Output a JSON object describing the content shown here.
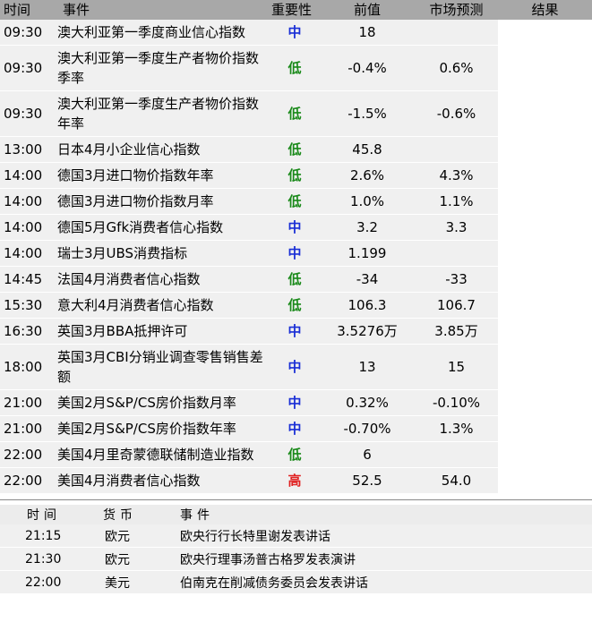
{
  "econ": {
    "headers": [
      "时间",
      "事件",
      "重要性",
      "前值",
      "市场预测",
      "结果"
    ],
    "rows": [
      {
        "time": "09:30",
        "event": "澳大利亚第一季度商业信心指数",
        "imp": "中",
        "lvl": "mid",
        "prev": "18",
        "fcst": ""
      },
      {
        "time": "09:30",
        "event": "澳大利亚第一季度生产者物价指数季率",
        "imp": "低",
        "lvl": "low",
        "prev": "-0.4%",
        "fcst": "0.6%"
      },
      {
        "time": "09:30",
        "event": "澳大利亚第一季度生产者物价指数年率",
        "imp": "低",
        "lvl": "low",
        "prev": "-1.5%",
        "fcst": "-0.6%"
      },
      {
        "time": "13:00",
        "event": "日本4月小企业信心指数",
        "imp": "低",
        "lvl": "low",
        "prev": "45.8",
        "fcst": ""
      },
      {
        "time": "14:00",
        "event": "德国3月进口物价指数年率",
        "imp": "低",
        "lvl": "low",
        "prev": "2.6%",
        "fcst": "4.3%"
      },
      {
        "time": "14:00",
        "event": "德国3月进口物价指数月率",
        "imp": "低",
        "lvl": "low",
        "prev": "1.0%",
        "fcst": "1.1%"
      },
      {
        "time": "14:00",
        "event": "德国5月Gfk消费者信心指数",
        "imp": "中",
        "lvl": "mid",
        "prev": "3.2",
        "fcst": "3.3"
      },
      {
        "time": "14:00",
        "event": "瑞士3月UBS消费指标",
        "imp": "中",
        "lvl": "mid",
        "prev": "1.199",
        "fcst": ""
      },
      {
        "time": "14:45",
        "event": "法国4月消费者信心指数",
        "imp": "低",
        "lvl": "low",
        "prev": "-34",
        "fcst": "-33"
      },
      {
        "time": "15:30",
        "event": "意大利4月消费者信心指数",
        "imp": "低",
        "lvl": "low",
        "prev": "106.3",
        "fcst": "106.7"
      },
      {
        "time": "16:30",
        "event": "英国3月BBA抵押许可",
        "imp": "中",
        "lvl": "mid",
        "prev": "3.5276万",
        "fcst": "3.85万"
      },
      {
        "time": "18:00",
        "event": "英国3月CBI分销业调查零售销售差额",
        "imp": "中",
        "lvl": "mid",
        "prev": "13",
        "fcst": "15"
      },
      {
        "time": "21:00",
        "event": "美国2月S&P/CS房价指数月率",
        "imp": "中",
        "lvl": "mid",
        "prev": "0.32%",
        "fcst": "-0.10%"
      },
      {
        "time": "21:00",
        "event": "美国2月S&P/CS房价指数年率",
        "imp": "中",
        "lvl": "mid",
        "prev": "-0.70%",
        "fcst": "1.3%"
      },
      {
        "time": "22:00",
        "event": "美国4月里奇蒙德联储制造业指数",
        "imp": "低",
        "lvl": "low",
        "prev": "6",
        "fcst": ""
      },
      {
        "time": "22:00",
        "event": "美国4月消费者信心指数",
        "imp": "高",
        "lvl": "high",
        "prev": "52.5",
        "fcst": "54.0"
      }
    ]
  },
  "speeches": {
    "headers": [
      "时间",
      "货币",
      "事件"
    ],
    "rows": [
      {
        "time": "21:15",
        "currency": "欧元",
        "event": "欧央行行长特里谢发表讲话"
      },
      {
        "time": "21:30",
        "currency": "欧元",
        "event": "欧央行理事汤普古格罗发表演讲"
      },
      {
        "time": "22:00",
        "currency": "美元",
        "event": "伯南克在削减债务委员会发表讲话"
      }
    ]
  }
}
